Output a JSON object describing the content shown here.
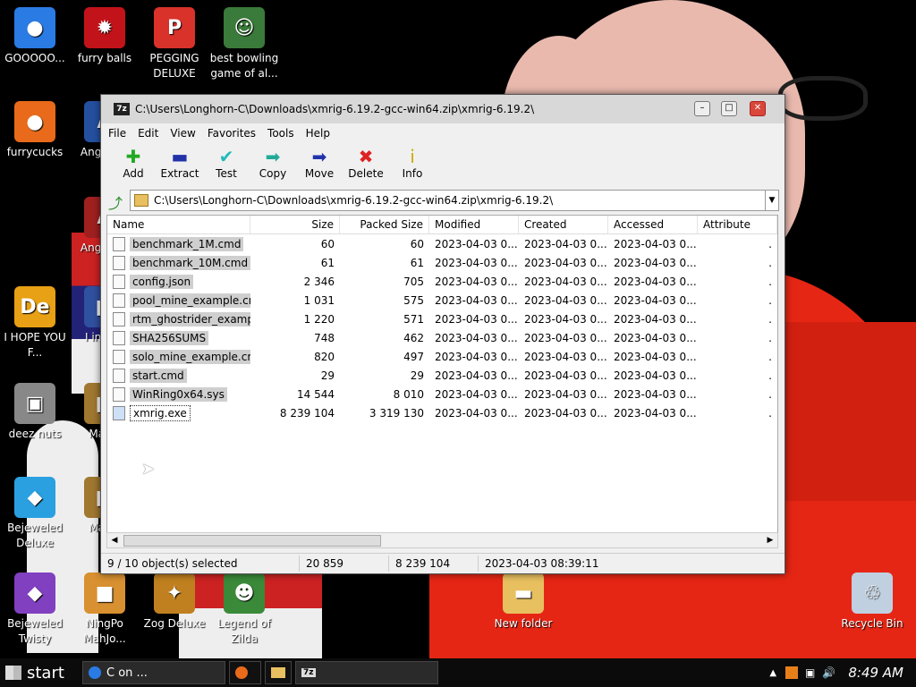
{
  "desktop": {
    "icons": [
      {
        "label": "GOOOOO...",
        "glyph": "●",
        "color": "#2a7be4"
      },
      {
        "label": "furry balls",
        "glyph": "✹",
        "color": "#c3131a"
      },
      {
        "label": "PEGGING DELUXE",
        "glyph": "P",
        "color": "#d8322a"
      },
      {
        "label": "best bowling game of al...",
        "glyph": "☺",
        "color": "#3a7a3a"
      },
      {
        "label": "furrycucks",
        "glyph": "●",
        "color": "#e86a1a"
      },
      {
        "label": "Angr Soy",
        "glyph": "A",
        "color": "#2550a0"
      },
      {
        "label": "Angr Soy",
        "glyph": "A",
        "color": "#a02020"
      },
      {
        "label": "I HOPE YOU F...",
        "glyph": "De",
        "color": "#e8a015"
      },
      {
        "label": "I in this",
        "glyph": "■",
        "color": "#3050a0"
      },
      {
        "label": "deez nuts",
        "glyph": "▣",
        "color": "#888888"
      },
      {
        "label": "Ma Es",
        "glyph": "■",
        "color": "#a07830"
      },
      {
        "label": "Bejeweled Deluxe",
        "glyph": "◆",
        "color": "#2aa0e0"
      },
      {
        "label": "Ma Es",
        "glyph": "■",
        "color": "#a07830"
      },
      {
        "label": "Bejeweled Twisty",
        "glyph": "◆",
        "color": "#8040c0"
      },
      {
        "label": "NingPo MahJo...",
        "glyph": "■",
        "color": "#d89030"
      },
      {
        "label": "Zog Deluxe",
        "glyph": "✦",
        "color": "#c08020"
      },
      {
        "label": "Legend of Zilda",
        "glyph": "☻",
        "color": "#3a8a3a"
      },
      {
        "label": "New folder",
        "glyph": "▬",
        "color": "#e8c060"
      },
      {
        "label": "Recycle Bin",
        "glyph": "♲",
        "color": "#c0d0e0"
      }
    ]
  },
  "window": {
    "title": "C:\\Users\\Longhorn-C\\Downloads\\xmrig-6.19.2-gcc-win64.zip\\xmrig-6.19.2\\",
    "app_icon": "7z",
    "menu": [
      "File",
      "Edit",
      "View",
      "Favorites",
      "Tools",
      "Help"
    ],
    "toolbar": [
      {
        "label": "Add",
        "glyph": "✚",
        "color": "#22aa22"
      },
      {
        "label": "Extract",
        "glyph": "▬",
        "color": "#2233aa"
      },
      {
        "label": "Test",
        "glyph": "✔",
        "color": "#22bbbb"
      },
      {
        "label": "Copy",
        "glyph": "➡",
        "color": "#22aa99"
      },
      {
        "label": "Move",
        "glyph": "➡",
        "color": "#2233aa"
      },
      {
        "label": "Delete",
        "glyph": "✖",
        "color": "#dd2222"
      },
      {
        "label": "Info",
        "glyph": "i",
        "color": "#ccaa00"
      }
    ],
    "address": "C:\\Users\\Longhorn-C\\Downloads\\xmrig-6.19.2-gcc-win64.zip\\xmrig-6.19.2\\",
    "columns": [
      "Name",
      "Size",
      "Packed Size",
      "Modified",
      "Created",
      "Accessed",
      "Attribute"
    ],
    "files": [
      {
        "name": "benchmark_1M.cmd",
        "size": "60",
        "packed": "60",
        "modified": "2023-04-03 0...",
        "created": "2023-04-03 0...",
        "accessed": "2023-04-03 0...",
        "attr": "."
      },
      {
        "name": "benchmark_10M.cmd",
        "size": "61",
        "packed": "61",
        "modified": "2023-04-03 0...",
        "created": "2023-04-03 0...",
        "accessed": "2023-04-03 0...",
        "attr": "."
      },
      {
        "name": "config.json",
        "size": "2 346",
        "packed": "705",
        "modified": "2023-04-03 0...",
        "created": "2023-04-03 0...",
        "accessed": "2023-04-03 0...",
        "attr": "."
      },
      {
        "name": "pool_mine_example.cmd",
        "size": "1 031",
        "packed": "575",
        "modified": "2023-04-03 0...",
        "created": "2023-04-03 0...",
        "accessed": "2023-04-03 0...",
        "attr": "."
      },
      {
        "name": "rtm_ghostrider_examp...",
        "size": "1 220",
        "packed": "571",
        "modified": "2023-04-03 0...",
        "created": "2023-04-03 0...",
        "accessed": "2023-04-03 0...",
        "attr": "."
      },
      {
        "name": "SHA256SUMS",
        "size": "748",
        "packed": "462",
        "modified": "2023-04-03 0...",
        "created": "2023-04-03 0...",
        "accessed": "2023-04-03 0...",
        "attr": "."
      },
      {
        "name": "solo_mine_example.cmd",
        "size": "820",
        "packed": "497",
        "modified": "2023-04-03 0...",
        "created": "2023-04-03 0...",
        "accessed": "2023-04-03 0...",
        "attr": "."
      },
      {
        "name": "start.cmd",
        "size": "29",
        "packed": "29",
        "modified": "2023-04-03 0...",
        "created": "2023-04-03 0...",
        "accessed": "2023-04-03 0...",
        "attr": "."
      },
      {
        "name": "WinRing0x64.sys",
        "size": "14 544",
        "packed": "8 010",
        "modified": "2023-04-03 0...",
        "created": "2023-04-03 0...",
        "accessed": "2023-04-03 0...",
        "attr": "."
      },
      {
        "name": "xmrig.exe",
        "size": "8 239 104",
        "packed": "3 319 130",
        "modified": "2023-04-03 0...",
        "created": "2023-04-03 0...",
        "accessed": "2023-04-03 0...",
        "attr": "."
      }
    ],
    "status": {
      "selection": "9 / 10 object(s) selected",
      "size": "20 859",
      "packed": "8 239 104",
      "date": "2023-04-03 08:39:11"
    }
  },
  "taskbar": {
    "start_label": "start",
    "tasks": [
      {
        "label": "C     on ..."
      },
      {
        "label": ""
      },
      {
        "label": ""
      },
      {
        "label": "7z"
      }
    ],
    "clock": "8:49 AM"
  }
}
